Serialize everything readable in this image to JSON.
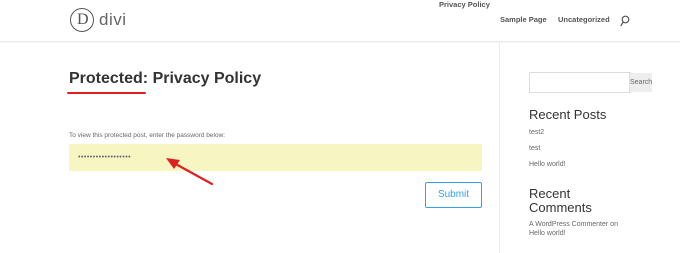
{
  "header": {
    "logo_letter": "D",
    "logo_text": "divi",
    "nav": [
      {
        "label": "Privacy Policy"
      },
      {
        "label": "Sample Page"
      },
      {
        "label": "Uncategorized"
      }
    ]
  },
  "main": {
    "title_prefix": "Protected:",
    "title_rest": " Privacy Policy",
    "protect_text": "To view this protected post, enter the password below:",
    "password_value": "••••••••••••••••••",
    "submit_label": "Submit"
  },
  "sidebar": {
    "search_button": "Search",
    "recent_posts_title": "Recent Posts",
    "recent_posts": [
      "test2",
      "test",
      "Hello world!"
    ],
    "recent_comments_title_line1": "Recent",
    "recent_comments_title_line2": "Comments",
    "comment_author": "A WordPress Commenter",
    "comment_on": " on",
    "comment_post": "Hello world!"
  },
  "colors": {
    "accent": "#2ea3f2",
    "annotation": "#e02020",
    "password_bg": "#f7f6c3"
  }
}
